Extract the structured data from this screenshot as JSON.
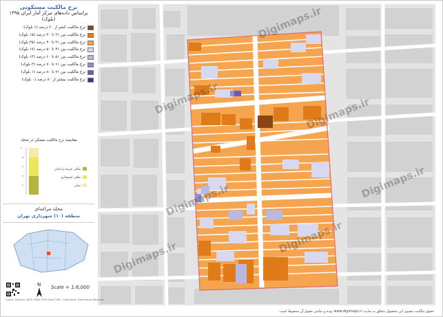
{
  "title": {
    "line1": "نرخ مالکیت مستکونی",
    "line2": "براساس داده‌های مرکز آمار ایران ۱۳۹۵",
    "line3": "(بلوک)"
  },
  "legend": [
    {
      "label": "نرخ مالکیت کمتر از ۲۰ درصد (۱ بلوک)",
      "color": "#8b4513"
    },
    {
      "label": "نرخ مالکیت بین ۲۱ تا ۳۰ درصد (۱۵ بلوک)",
      "color": "#e07b1a"
    },
    {
      "label": "نرخ مالکیت بین ۳۱ تا ۴۰ درصد (۳۵ بلوک)",
      "color": "#f5a550"
    },
    {
      "label": "نرخ مالکیت بین ۴۱ تا ۵۰ درصد (۱۷ بلوک)",
      "color": "#d8d8ee"
    },
    {
      "label": "نرخ مالکیت بین ۵۱ تا ۶۰ درصد (۱۳ بلوک)",
      "color": "#b8b8e0"
    },
    {
      "label": "نرخ مالکیت بین ۶۱ تا ۷۰ درصد (۳ بلوک)",
      "color": "#8f8fcf"
    },
    {
      "label": "نرخ مالکیت بین ۷۱ تا ۸۰ درصد (۱ بلوک)",
      "color": "#6b5bb5"
    },
    {
      "label": "نرخ مالکیت بیشتر از ۸۰ درصد (۰ بلوک)",
      "color": "#4b2a8a"
    }
  ],
  "chart_data": {
    "type": "bar",
    "title": "مقایسه نرخ مالکیت مسکن در محله",
    "categories": [
      ""
    ],
    "series": [
      {
        "name": "ملکی عرصه و اعیان",
        "color": "#b5b53a",
        "values": [
          40
        ]
      },
      {
        "name": "ملکی استیجاری",
        "color": "#e8e85a",
        "values": [
          40
        ]
      },
      {
        "name": "سایر",
        "color": "#f8e9a8",
        "values": [
          20
        ]
      }
    ],
    "ylim": [
      0,
      100
    ],
    "ytick_labels": [
      "۰",
      "۲۰",
      "۴۰",
      "۶۰",
      "۸۰",
      "۱۰۰"
    ]
  },
  "place": {
    "neighborhood": "محله مراغه‌ای",
    "region": "منطقه (۱۰) شهرداری تهران"
  },
  "scale": "Scale = 1:6,000",
  "footnote_left": "Coord. System: WGS 1984 UTM Zone 39N - Projection: Transverse Mercator",
  "credit": "حقوق مالکیت معنوی این محصول متعلق به سایت www.digimaps.ir بوده و تمامی حقوق آن محفوظ است.",
  "watermark": "Digimaps.ir",
  "colors": {
    "street_bg": "#e8e8e8",
    "road_white": "#ffffff",
    "boundary": "#e06a6a"
  }
}
